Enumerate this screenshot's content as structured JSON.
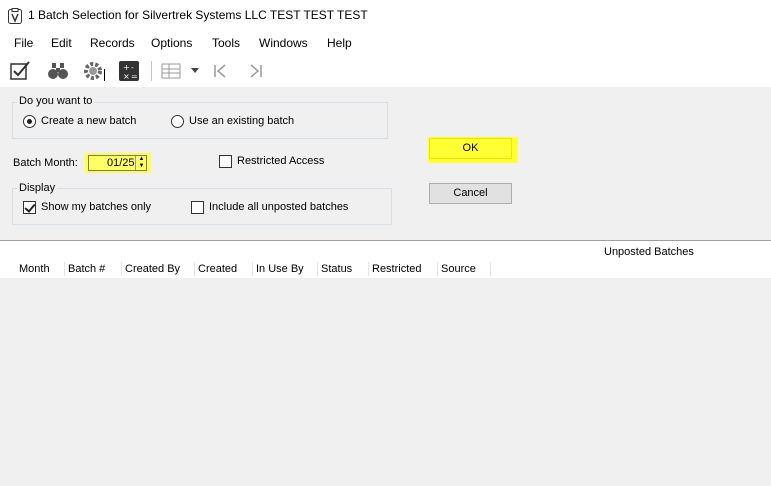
{
  "window": {
    "title": "1 Batch Selection for Silvertrek Systems LLC TEST TEST TEST"
  },
  "menu": [
    "File",
    "Edit",
    "Records",
    "Options",
    "Tools",
    "Windows",
    "Help"
  ],
  "toolbar": {
    "icons": [
      "edit-check-icon",
      "binoculars-icon",
      "gear-icon",
      "calculator-icon",
      "grid-options-icon",
      "dropdown-caret-icon",
      "first-record-icon",
      "last-record-icon"
    ]
  },
  "want_group": {
    "title": "Do you want to",
    "option_new": "Create a new batch",
    "option_existing": "Use an existing batch",
    "selected": "Create a new batch"
  },
  "batch_month": {
    "label": "Batch Month:",
    "value": "01/25"
  },
  "restricted_access": {
    "label": "Restricted Access",
    "checked": false
  },
  "display_group": {
    "title": "Display",
    "show_mine": {
      "label": "Show my batches only",
      "checked": true
    },
    "include_all": {
      "label": "Include all unposted batches",
      "checked": false
    }
  },
  "buttons": {
    "ok": "OK",
    "cancel": "Cancel"
  },
  "grid": {
    "caption": "Unposted Batches",
    "columns": [
      "Month",
      "Batch #",
      "Created By",
      "Created",
      "In Use By",
      "Status",
      "Restricted",
      "Source"
    ]
  },
  "colors": {
    "highlight": "#ffff33",
    "panel": "#f0f0f0"
  }
}
